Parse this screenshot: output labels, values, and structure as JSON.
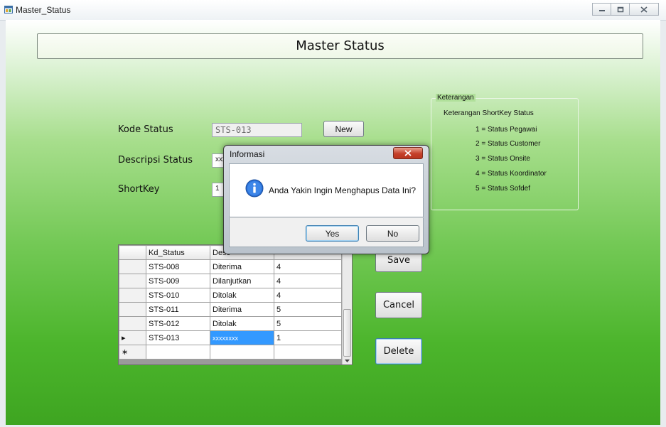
{
  "window": {
    "title": "Master_Status",
    "app_icon": "form-icon",
    "buttons": [
      "minimize-icon",
      "maximize-icon",
      "close-icon"
    ]
  },
  "form": {
    "header_title": "Master Status",
    "kode_status_label": "Kode Status",
    "kode_status_value": "STS-013",
    "new_button": "New",
    "deskripsi_label": "Descripsi Status",
    "deskripsi_value": "xxxx",
    "shortkey_label": "ShortKey",
    "shortkey_value": "1",
    "save_button": "Save",
    "cancel_button": "Cancel",
    "delete_button": "Delete"
  },
  "keterangan": {
    "legend": "Keterangan",
    "heading": "Keterangan ShortKey Status",
    "items": [
      "1 = Status Pegawai",
      "2 = Status Customer",
      "3 = Status Onsite",
      "4 = Status Koordinator",
      "5 = Status Sofdef"
    ]
  },
  "grid": {
    "columns": [
      "Kd_Status",
      "Desc",
      ""
    ],
    "rows": [
      {
        "indicator": "",
        "kd": "STS-008",
        "desc": "Diterima",
        "key": "4"
      },
      {
        "indicator": "",
        "kd": "STS-009",
        "desc": "Dilanjutkan",
        "key": "4"
      },
      {
        "indicator": "",
        "kd": "STS-010",
        "desc": "Ditolak",
        "key": "4"
      },
      {
        "indicator": "",
        "kd": "STS-011",
        "desc": "Diterima",
        "key": "5"
      },
      {
        "indicator": "",
        "kd": "STS-012",
        "desc": "Ditolak",
        "key": "5"
      },
      {
        "indicator": "▸",
        "kd": "STS-013",
        "desc": "xxxxxxxx",
        "key": "1"
      },
      {
        "indicator": "∗",
        "kd": "",
        "desc": "",
        "key": ""
      }
    ]
  },
  "dialog": {
    "title": "Informasi",
    "message": "Anda Yakin Ingin Menghapus Data Ini?",
    "icon": "info-icon",
    "yes_button": "Yes",
    "no_button": "No",
    "close_icon": "close-icon"
  },
  "colors": {
    "gradient_top": "#ffffff",
    "gradient_bottom": "#3ea521",
    "selection": "#3399ff",
    "dialog_close": "#c5402a"
  }
}
